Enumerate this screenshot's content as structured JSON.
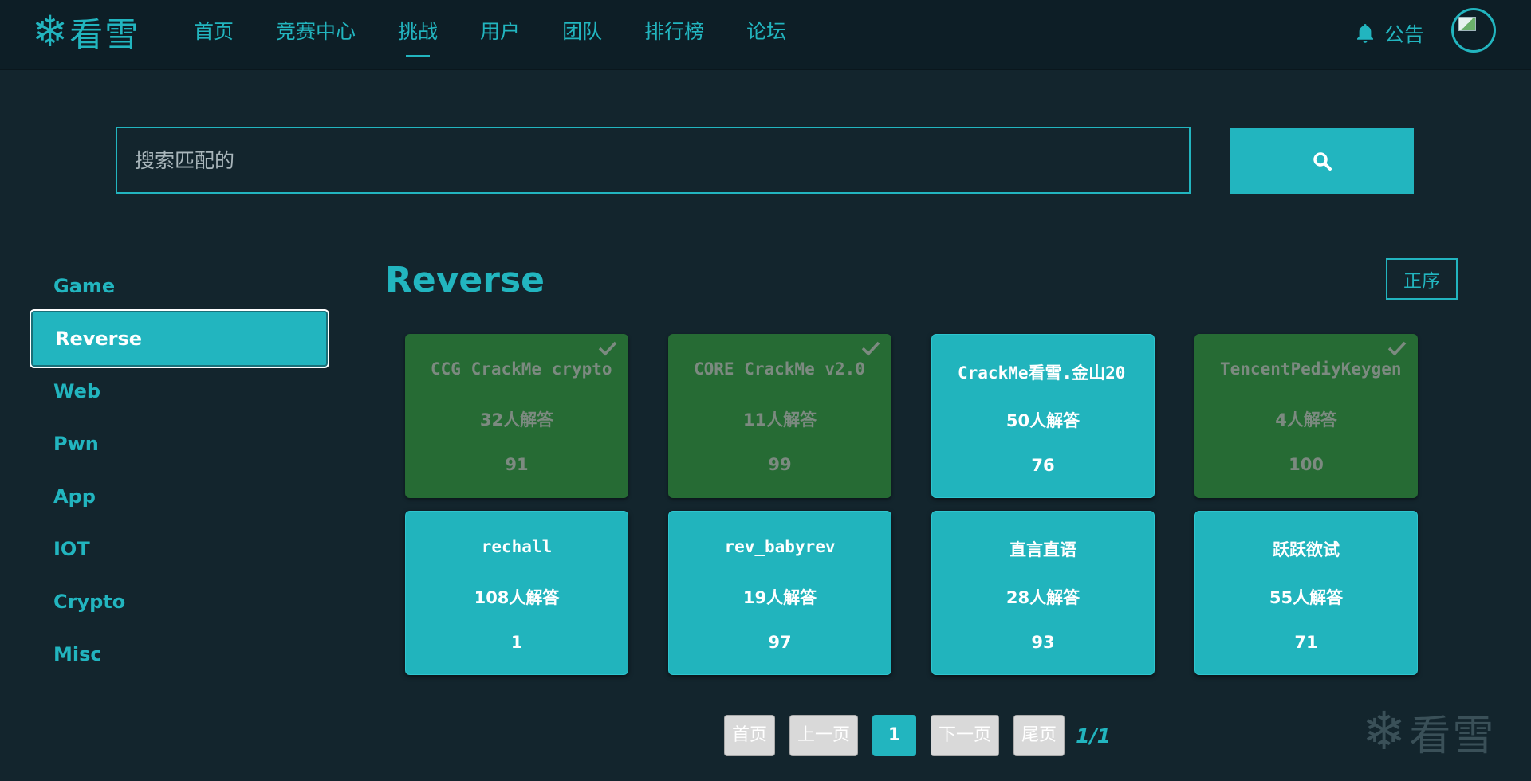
{
  "brand": {
    "logo_text": "看雪"
  },
  "nav": {
    "items": [
      {
        "label": "首页",
        "active": false
      },
      {
        "label": "竞赛中心",
        "active": false
      },
      {
        "label": "挑战",
        "active": true
      },
      {
        "label": "用户",
        "active": false
      },
      {
        "label": "团队",
        "active": false
      },
      {
        "label": "排行榜",
        "active": false
      },
      {
        "label": "论坛",
        "active": false
      }
    ],
    "notice_label": "公告"
  },
  "search": {
    "placeholder": "搜索匹配的",
    "value": ""
  },
  "sidebar": {
    "items": [
      {
        "label": "Game",
        "active": false
      },
      {
        "label": "Reverse",
        "active": true
      },
      {
        "label": "Web",
        "active": false
      },
      {
        "label": "Pwn",
        "active": false
      },
      {
        "label": "App",
        "active": false
      },
      {
        "label": "IOT",
        "active": false
      },
      {
        "label": "Crypto",
        "active": false
      },
      {
        "label": "Misc",
        "active": false
      }
    ]
  },
  "main": {
    "title": "Reverse",
    "sort_label": "正序",
    "challenges": [
      {
        "name": "CCG CrackMe crypto",
        "solves": "32人解答",
        "score": "91",
        "solved": true
      },
      {
        "name": "CORE CrackMe v2.0",
        "solves": "11人解答",
        "score": "99",
        "solved": true
      },
      {
        "name": "CrackMe看雪.金山20",
        "solves": "50人解答",
        "score": "76",
        "solved": false
      },
      {
        "name": "TencentPediyKeygen",
        "solves": "4人解答",
        "score": "100",
        "solved": true
      },
      {
        "name": "rechall",
        "solves": "108人解答",
        "score": "1",
        "solved": false
      },
      {
        "name": "rev_babyrev",
        "solves": "19人解答",
        "score": "97",
        "solved": false
      },
      {
        "name": "直言直语",
        "solves": "28人解答",
        "score": "93",
        "solved": false
      },
      {
        "name": "跃跃欲试",
        "solves": "55人解答",
        "score": "71",
        "solved": false
      }
    ]
  },
  "pagination": {
    "first": "首页",
    "prev": "上一页",
    "current": "1",
    "next": "下一页",
    "last": "尾页",
    "info": "1/1"
  },
  "watermark": {
    "text": "看雪"
  },
  "colors": {
    "accent": "#22b5bf",
    "background": "#13252d",
    "topbar": "#0d1e26",
    "solved_card": "#266b34",
    "open_card": "#21b4bd"
  },
  "icons": [
    "snowflake-logo-icon",
    "bell-icon",
    "search-icon",
    "check-icon"
  ]
}
